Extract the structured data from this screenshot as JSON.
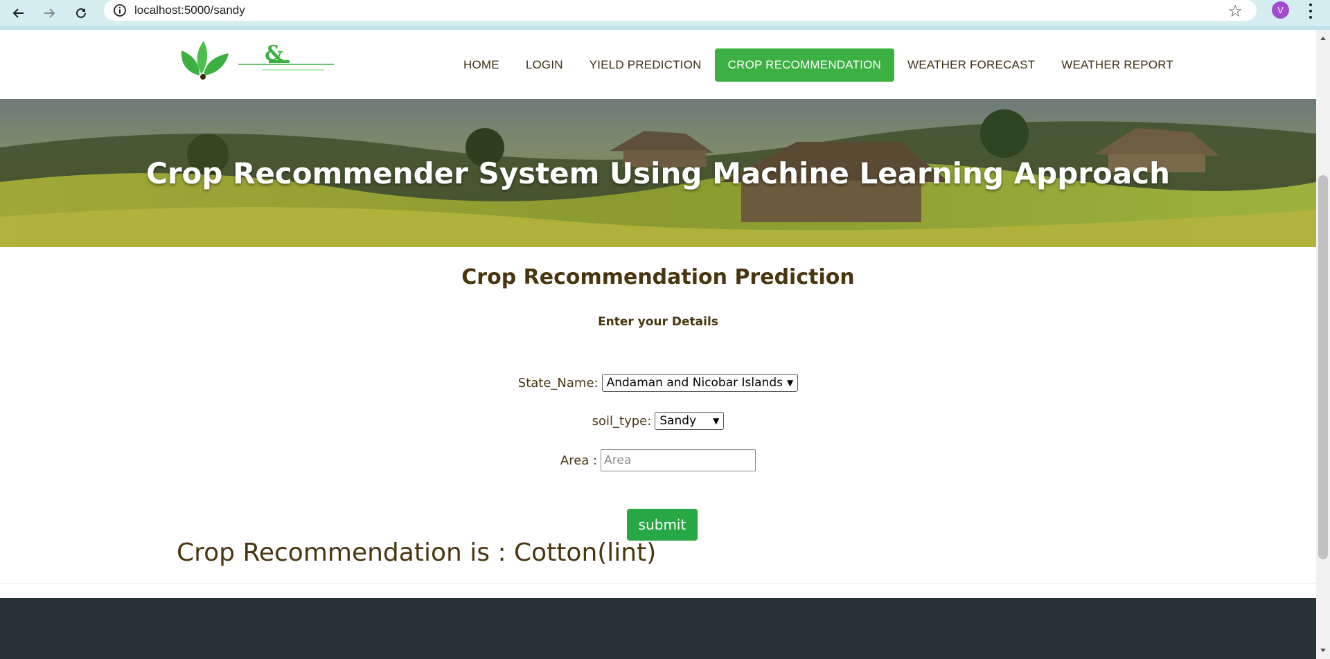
{
  "browser": {
    "url": "localhost:5000/sandy",
    "profile_initial": "V"
  },
  "header": {
    "nav": [
      {
        "label": "HOME",
        "active": false
      },
      {
        "label": "LOGIN",
        "active": false
      },
      {
        "label": "YIELD PREDICTION",
        "active": false
      },
      {
        "label": "CROP RECOMMENDATION",
        "active": true
      },
      {
        "label": "WEATHER FORECAST",
        "active": false
      },
      {
        "label": "WEATHER REPORT",
        "active": false
      }
    ]
  },
  "hero": {
    "title": "Crop Recommender System Using Machine Learning Approach"
  },
  "form": {
    "title": "Crop Recommendation Prediction",
    "subtitle": "Enter your Details",
    "state_label": "State_Name:",
    "state_value": "Andaman and Nicobar Islands",
    "soil_label": "soil_type:",
    "soil_value": "Sandy",
    "area_label": "Area :",
    "area_placeholder": "Area",
    "submit_label": "submit"
  },
  "result": {
    "text": "Crop Recommendation is : Cotton(lint)"
  },
  "colors": {
    "accent_green": "#3cb043",
    "text_brown": "#4a3511",
    "footer_dark": "#263238"
  }
}
